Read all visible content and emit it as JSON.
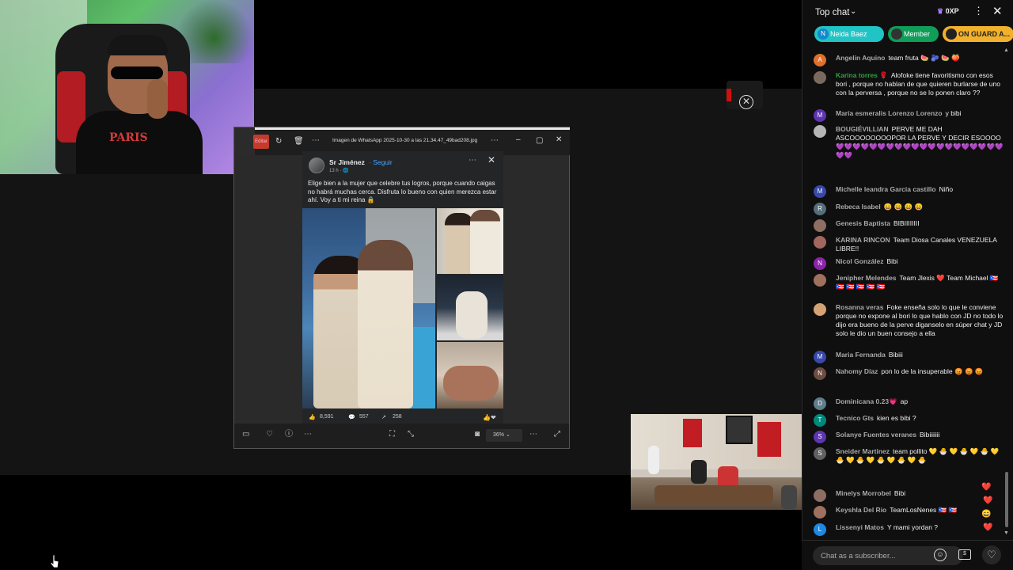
{
  "viewer": {
    "edit_label": "Editar",
    "filename": "Imagen de WhatsApp 2025-10-30 a las 21.34.47_49bad208.jpg",
    "zoom": "36%",
    "post": {
      "author": "Sr Jiménez",
      "follow": "· Seguir",
      "time": "13 h · 🌐",
      "text": "Elige bien a la mujer que celebre tus logros, porque cuando caigas no habrá muchas cerca. Disfruta lo bueno con quien merezca estar ahí. Voy a ti mi reina 🔒",
      "likes": "8,591",
      "comments": "557",
      "shares": "258"
    }
  },
  "webcam": {
    "shirt_text": "PARIS"
  },
  "chat": {
    "title": "Top chat",
    "xp": "0XP",
    "pinned": [
      {
        "initial": "N",
        "label": "Neida Baez"
      },
      {
        "initial": "",
        "label": "Member"
      },
      {
        "initial": "",
        "label": "ON GUARD A..."
      }
    ],
    "input_placeholder": "Chat as a subscriber...",
    "messages": [
      {
        "initial": "A",
        "color": "#e0702d",
        "author": "Angelin Aquino",
        "member": false,
        "text": "team fruta 🍉 🫐 🍉 🍑"
      },
      {
        "initial": "",
        "color": "#7a6a5e",
        "author": "Karina torres 🌹",
        "member": true,
        "text": "Alofoke tiene favoritismo con esos bori , porque no hablan de que quieren burlarse de uno con la perversa , porque no se lo ponen claro ??"
      },
      {
        "initial": "M",
        "color": "#5e35b1",
        "author": "María esmeralis Lorenzo Lorenzo",
        "member": false,
        "text": "y bibi"
      },
      {
        "initial": "",
        "color": "#b5b5b5",
        "author": "BOUGIÉVILLIAN",
        "member": false,
        "text": "PERVE ME DAH ASCOOOOOOOOPOR LA PERVE Y DECIR ESOOOO 💜💜💜💜💜💜💜💜💜💜💜💜💜💜💜💜💜💜💜💜💜💜"
      },
      {
        "initial": "M",
        "color": "#3949ab",
        "author": "Michelle leandra Garcia castillo",
        "member": false,
        "text": "Niño"
      },
      {
        "initial": "R",
        "color": "#546e7a",
        "author": "Rebeca Isabel",
        "member": false,
        "text": "😄 😄 😄 😄"
      },
      {
        "initial": "",
        "color": "#8d6e63",
        "author": "Genesis Baptista",
        "member": false,
        "text": "BIBIIIIIIII"
      },
      {
        "initial": "",
        "color": "#a1665e",
        "author": "KARINA RINCON",
        "member": false,
        "text": "Team Diosa Canales VENEZUELA LIBRE!!"
      },
      {
        "initial": "N",
        "color": "#8e24aa",
        "author": "Nicol González",
        "member": false,
        "text": "Bibi"
      },
      {
        "initial": "",
        "color": "#a0705e",
        "author": "Jenipher Melendes",
        "member": false,
        "text": "Team Jlexis ❤️ Team Michael 🇵🇷 🇵🇷 🇵🇷 🇵🇷 🇵🇷 🇵🇷"
      },
      {
        "initial": "",
        "color": "#d4a373",
        "author": "Rosanna veras",
        "member": false,
        "text": "Foke enseña solo lo que le conviene porque no expone al bori lo que hablo con JD no todo lo dijo era bueno de la perve diganselo en súper chat y JD solo le dio un buen consejo a ella"
      },
      {
        "initial": "M",
        "color": "#3949ab",
        "author": "Maria Fernanda",
        "member": false,
        "text": "Bibiii"
      },
      {
        "initial": "N",
        "color": "#6d4c41",
        "author": "Nahomy Díaz",
        "member": false,
        "text": "pon lo de la insuperable 😡 😡 😡"
      },
      {
        "initial": "D",
        "color": "#607d8b",
        "author": "Dominicana 0.23💗",
        "member": false,
        "text": "ap"
      },
      {
        "initial": "T",
        "color": "#00897b",
        "author": "Tecnico Gts",
        "member": false,
        "text": "kien es bibi ?"
      },
      {
        "initial": "S",
        "color": "#5e35b1",
        "author": "Solanye Fuentes veranes",
        "member": false,
        "text": "Bibiiiiiii"
      },
      {
        "initial": "S",
        "color": "#616161",
        "author": "Sneider Martinez",
        "member": false,
        "text": "team pollito 💛 🐣 💛 🐣 💛 🐣 💛 🐣 💛 🐣 💛 🐣 💛 🐣 💛 🐣"
      },
      {
        "initial": "",
        "color": "#8d6e63",
        "author": "Minelys Morrobel",
        "member": false,
        "text": "Bibi"
      },
      {
        "initial": "",
        "color": "#a0705e",
        "author": "Keyshla Del Rio",
        "member": false,
        "text": "TeamLosNenes 🇵🇷 🇵🇷"
      },
      {
        "initial": "L",
        "color": "#1e88e5",
        "author": "Lissenyi Matos",
        "member": false,
        "text": "Y mami yordan ?"
      }
    ],
    "floating_reactions": [
      "❤️",
      "❤️",
      "😄",
      "❤️"
    ]
  }
}
